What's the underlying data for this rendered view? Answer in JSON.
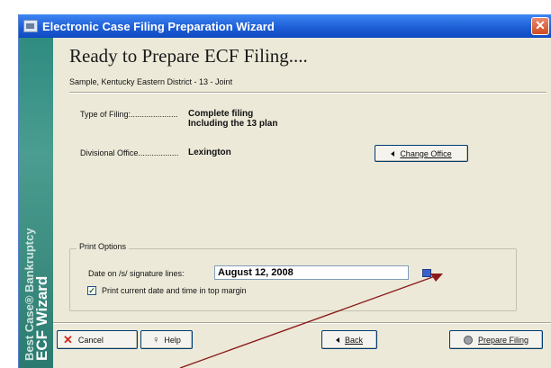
{
  "window": {
    "title": "Electronic Case Filing Preparation Wizard",
    "close_glyph": "✕"
  },
  "sidebar": {
    "brand_line1": "Best Case® Bankruptcy",
    "brand_line2": "ECF Wizard"
  },
  "header": {
    "title": "Ready to Prepare ECF Filing....",
    "case_info": "Sample, Kentucky Eastern District - 13 - Joint"
  },
  "filing": {
    "type_label": "Type of Filing:.....................",
    "type_value_line1": "Complete filing",
    "type_value_line2": "Including the 13 plan",
    "office_label": "Divisional Office..................",
    "office_value": "Lexington",
    "change_office_button": "Change Office"
  },
  "print_options": {
    "group_title": "Print Options",
    "date_label": "Date on /s/ signature lines:",
    "date_value": "August 12, 2008",
    "print_checkbox_label": "Print current date and time in top margin",
    "print_checked": true
  },
  "footer": {
    "cancel_button": "Cancel",
    "help_button": "Help",
    "back_button": "Back",
    "prepare_button": "Prepare Filing"
  },
  "icons": {
    "cancel": "cancel-x-icon",
    "help": "help-pin-icon",
    "back": "triangle-left-icon",
    "prepare": "prepare-filing-icon",
    "calendar": "calendar-icon"
  },
  "colors": {
    "titlebar": "#1f5fd6",
    "sidebar": "#3e8e82",
    "window_bg": "#ece9d8",
    "arrow": "#8b1a1a"
  }
}
